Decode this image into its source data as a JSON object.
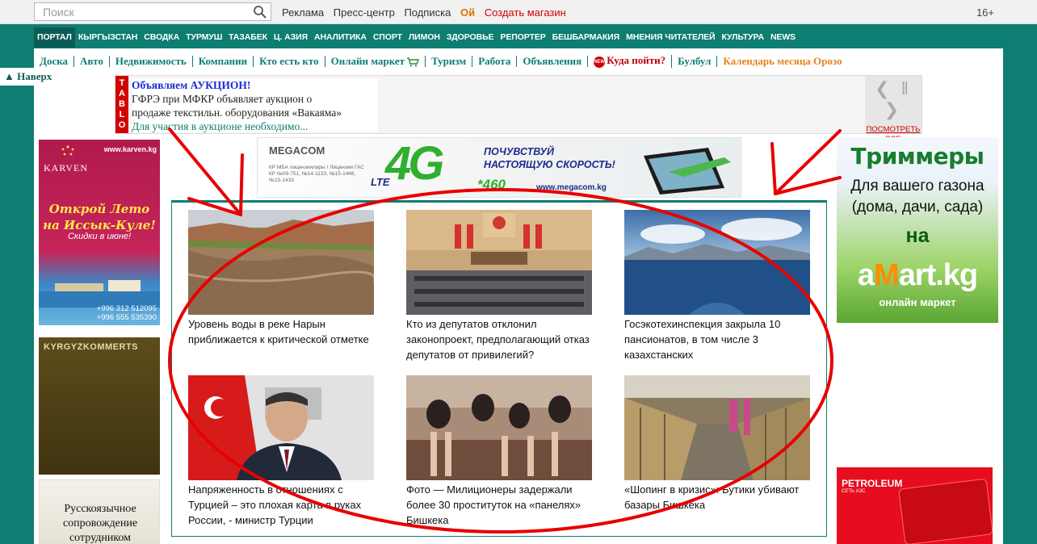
{
  "topbar": {
    "search_placeholder": "Поиск",
    "links": [
      "Реклама",
      "Пресс-центр",
      "Подписка"
    ],
    "oy": "Ой",
    "create_shop": "Создать магазин",
    "age": "16+"
  },
  "nav": {
    "items": [
      "ПОРТАЛ",
      "КЫРГЫЗСТАН",
      "СВОДКА",
      "ТУРМУШ",
      "ТАЗАБЕК",
      "Ц. АЗИЯ",
      "АНАЛИТИКА",
      "СПОРТ",
      "ЛИМОН",
      "ЗДОРОВЬЕ",
      "РЕПОРТЕР",
      "БЕШБАРМАКИЯ",
      "МНЕНИЯ ЧИТАТЕЛЕЙ",
      "КУЛЬТУРА",
      "NEWS"
    ]
  },
  "subnav": {
    "items": [
      "Доска",
      "Авто",
      "Недвижимость",
      "Компании",
      "Кто есть кто",
      "Онлайн маркет",
      "Туризм",
      "Работа",
      "Объявления"
    ],
    "new_badge": "NEW",
    "where_to_go": "Куда пойти?",
    "bulbul": "Булбул",
    "calendar": "Календарь месяца Орозо"
  },
  "back_to_top": "▲ Наверх",
  "tablo": {
    "strip": [
      "T",
      "A",
      "B",
      "L",
      "O"
    ],
    "headline": "Объявляем АУКЦИОН!",
    "line2": "ГФРЭ при МФКР объявляет аукцион о",
    "line3": "продаже текстильн. оборудования «Вакаяма»",
    "line4": "Для участия в аукционе необходимо...",
    "arrows": "❮ ‖ ❯",
    "view_all": "ПОСМОТРЕТЬ ВСЕ"
  },
  "ads": {
    "karven": {
      "site": "www.karven.kg",
      "brand": "KARVEN",
      "slogan": "Открой Лето на Иссык-Куле!",
      "sub": "Скидки в июне!",
      "phone1": "+996 312 512095",
      "phone2": "+996 555 535390"
    },
    "kk": {
      "brand": "KYRGYZKOMMERTS"
    },
    "rus": {
      "text": "Русскоязычное сопровождение сотрудником"
    },
    "megacom": {
      "brand": "MEGACOM",
      "license": "КР МБА лицензиялары / Лицензии ГАС КР №09-751, №14-1133, №15-1446, №15-1433",
      "lte": "LTE",
      "g4": "4G",
      "slogan1": "ПОЧУВСТВУЙ",
      "slogan2": "НАСТОЯЩУЮ СКОРОСТЬ!",
      "number": "*460",
      "url": "www.megacom.kg"
    },
    "trimmers": {
      "t1": "Триммеры",
      "t2": "Для вашего газона (дома, дачи, сада)",
      "t3": "на",
      "t4a": "a",
      "t4m": "M",
      "t4b": "art.kg",
      "t5": "онлайн маркет"
    },
    "petroleum": {
      "name": "PETROLEUM",
      "sub": "СЕТЬ АЗС"
    }
  },
  "news": [
    {
      "title": "Уровень воды в реке Нарын приближается к критической отметке",
      "image": "river"
    },
    {
      "title": "Кто из депутатов отклонил законопроект, предполагающий отказ депутатов от привилегий?",
      "image": "parliament"
    },
    {
      "title": "Госэкотехинспекция закрыла 10 пансионатов, в том числе 3 казахстанских",
      "image": "lake"
    },
    {
      "title": "Напряженность в отношениях с Турцией – это плохая карта в руках России, - министр Турции",
      "image": "minister"
    },
    {
      "title": "Фото — Милиционеры задержали более 30 проституток на «панелях» Бишкека",
      "image": "detained"
    },
    {
      "title": "«Шопинг в кризис»: Бутики убивают базары Бишкека",
      "image": "bazaar"
    }
  ],
  "colors": {
    "brand": "#0e7d72",
    "annotation": "#e80000"
  }
}
